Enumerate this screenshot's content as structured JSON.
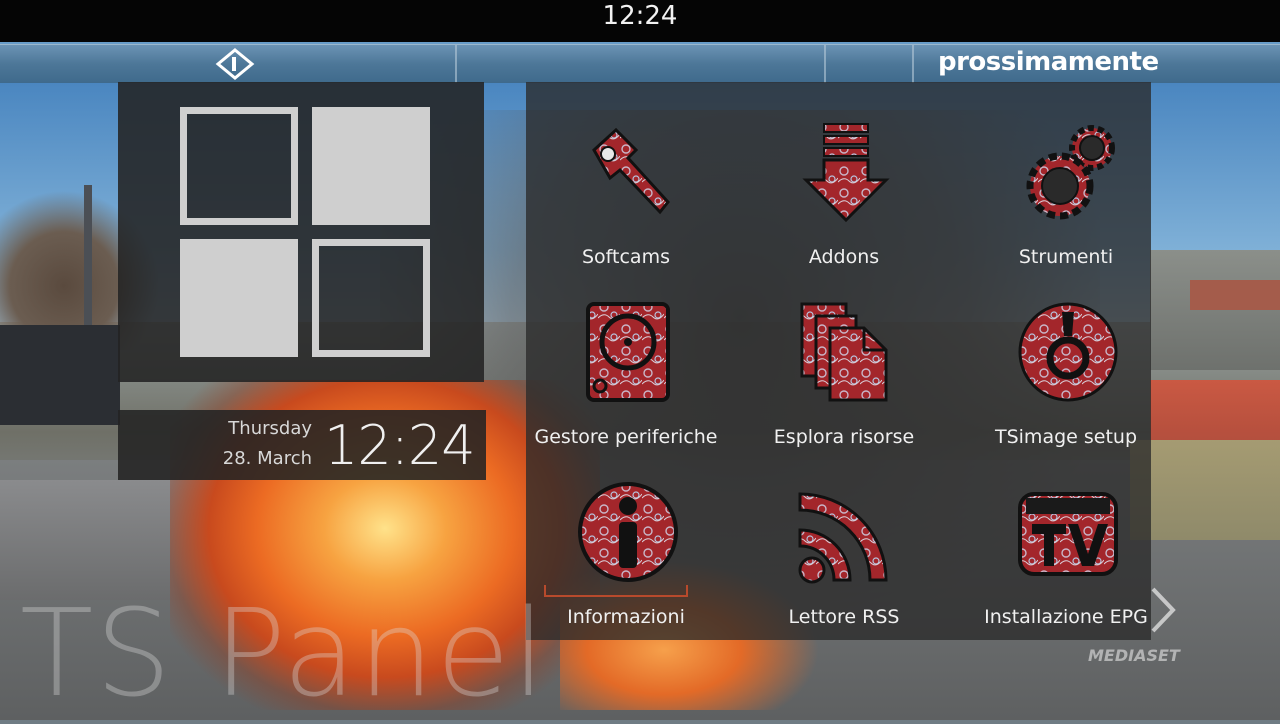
{
  "status_bar": {
    "clock": "12:24"
  },
  "banner": {
    "promo_text": "prossimamente"
  },
  "datetime": {
    "weekday": "Thursday",
    "date": "28. March",
    "time": "12:24"
  },
  "menu": {
    "items": [
      {
        "label": "Softcams",
        "icon": "wrench-icon"
      },
      {
        "label": "Addons",
        "icon": "download-arrow-icon"
      },
      {
        "label": "Strumenti",
        "icon": "gears-icon"
      },
      {
        "label": "Gestore periferiche",
        "icon": "hard-drive-icon"
      },
      {
        "label": "Esplora risorse",
        "icon": "files-icon"
      },
      {
        "label": "TSimage setup",
        "icon": "dial-icon"
      },
      {
        "label": "Informazioni",
        "icon": "info-icon"
      },
      {
        "label": "Lettore RSS",
        "icon": "rss-icon"
      },
      {
        "label": "Installazione EPG",
        "icon": "assisitenza-tv-icon"
      }
    ],
    "selected_index": 6
  },
  "watermark": "TS Panel",
  "channel_logo_text": "MEDIASET",
  "colors": {
    "accent": "#b84a2c",
    "icon_red": "#9e2a2b",
    "panel": "#2a2a2a"
  }
}
